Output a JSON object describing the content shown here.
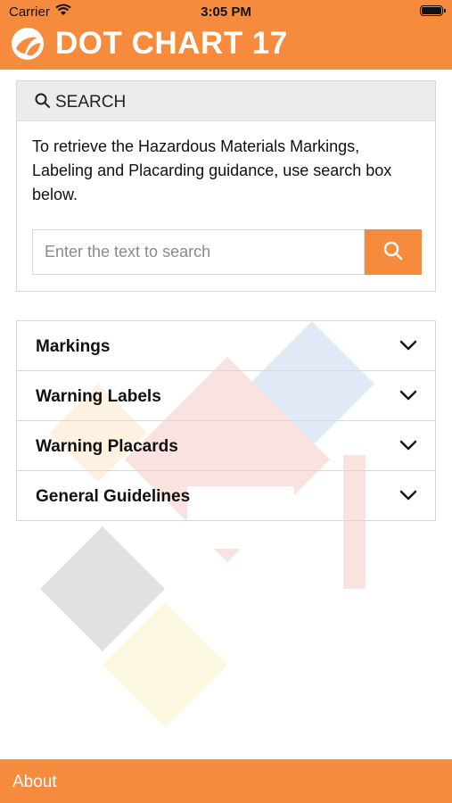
{
  "status_bar": {
    "carrier": "Carrier",
    "time": "3:05 PM"
  },
  "header": {
    "title": "DOT CHART 17"
  },
  "search": {
    "heading": "SEARCH",
    "instructions": "To retrieve the Hazardous Materials Markings, Labeling and Placarding guidance, use search box below.",
    "placeholder": "Enter the text to search"
  },
  "sections": [
    {
      "label": "Markings"
    },
    {
      "label": "Warning Labels"
    },
    {
      "label": "Warning Placards"
    },
    {
      "label": "General Guidelines"
    }
  ],
  "footer": {
    "about": "About"
  },
  "colors": {
    "accent": "#f68a3d",
    "panel_header": "#ececec",
    "border": "#d8d8d8"
  },
  "icons": [
    "wifi-icon",
    "battery-icon",
    "dot-logo-icon",
    "search-icon",
    "chevron-down-icon"
  ]
}
